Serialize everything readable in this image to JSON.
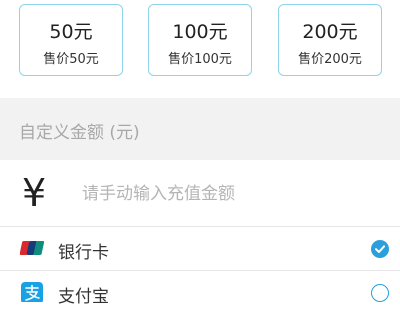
{
  "amount_options": [
    {
      "value": "50元",
      "price": "售价50元"
    },
    {
      "value": "100元",
      "price": "售价100元"
    },
    {
      "value": "200元",
      "price": "售价200元"
    }
  ],
  "custom_amount": {
    "header": "自定义金额 (元)",
    "currency_symbol": "¥",
    "placeholder": "请手动输入充值金额"
  },
  "payment_methods": [
    {
      "label": "银行卡",
      "icon": "unionpay-icon",
      "selected": true
    },
    {
      "label": "支付宝",
      "icon": "alipay-icon",
      "selected": false
    }
  ],
  "colors": {
    "accent": "#2a9fdc",
    "card_border": "#8fd3ec",
    "section_bg": "#f2f2f2"
  }
}
